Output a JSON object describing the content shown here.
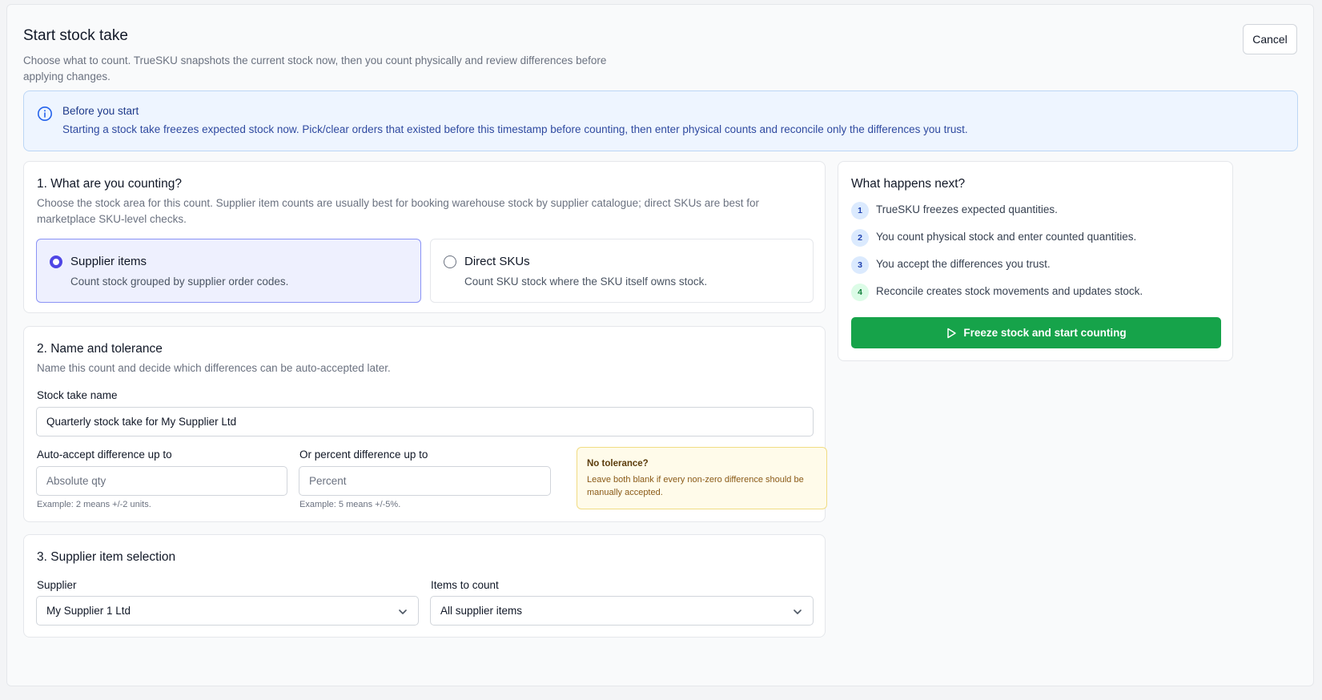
{
  "header": {
    "title": "Start stock take",
    "subtitle": "Choose what to count. TrueSKU snapshots the current stock now, then you count physically and review differences before applying changes.",
    "cancel_label": "Cancel"
  },
  "info_banner": {
    "title": "Before you start",
    "text": "Starting a stock take freezes expected stock now. Pick/clear orders that existed before this timestamp before counting, then enter physical counts and reconcile only the differences you trust."
  },
  "section1": {
    "title": "1. What are you counting?",
    "description": "Choose the stock area for this count. Supplier item counts are usually best for booking warehouse stock by supplier catalogue; direct SKUs are best for marketplace SKU-level checks.",
    "options": [
      {
        "title": "Supplier items",
        "description": "Count stock grouped by supplier order codes.",
        "selected": true
      },
      {
        "title": "Direct SKUs",
        "description": "Count SKU stock where the SKU itself owns stock.",
        "selected": false
      }
    ]
  },
  "section2": {
    "title": "2. Name and tolerance",
    "description": "Name this count and decide which differences can be auto-accepted later.",
    "name_label": "Stock take name",
    "name_value": "Quarterly stock take for My Supplier Ltd",
    "abs_label": "Auto-accept difference up to",
    "abs_placeholder": "Absolute qty",
    "abs_hint": "Example: 2 means +/-2 units.",
    "pct_label": "Or percent difference up to",
    "pct_placeholder": "Percent",
    "pct_hint": "Example: 5 means +/-5%.",
    "note_title": "No tolerance?",
    "note_text": "Leave both blank if every non-zero difference should be manually accepted."
  },
  "section3": {
    "title": "3. Supplier item selection",
    "supplier_label": "Supplier",
    "supplier_value": "My Supplier 1 Ltd",
    "items_label": "Items to count",
    "items_value": "All supplier items"
  },
  "next": {
    "title": "What happens next?",
    "steps": [
      {
        "num": "1",
        "text": "TrueSKU freezes expected quantities."
      },
      {
        "num": "2",
        "text": "You count physical stock and enter counted quantities."
      },
      {
        "num": "3",
        "text": "You accept the differences you trust."
      },
      {
        "num": "4",
        "text": "Reconcile creates stock movements and updates stock."
      }
    ],
    "button_label": "Freeze stock and start counting"
  },
  "colors": {
    "primary": "#4f46e5",
    "success": "#16a34a",
    "info_bg": "#eef5ff",
    "warning_bg": "#fffbea"
  },
  "icons": [
    "info-icon",
    "chevron-down-icon",
    "play-icon"
  ]
}
